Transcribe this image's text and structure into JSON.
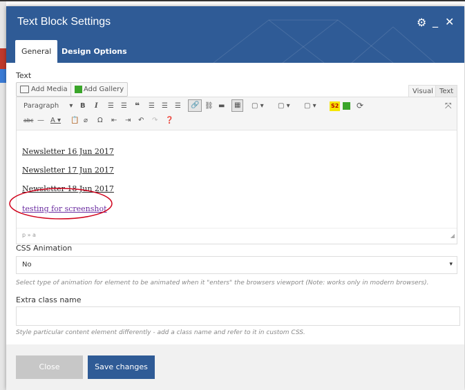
{
  "modal": {
    "title": "Text Block Settings",
    "tabs": [
      {
        "label": "General",
        "active": true
      },
      {
        "label": "Design Options",
        "active": false
      }
    ],
    "icons": {
      "settings": "gear-icon",
      "minimize": "minimize-icon",
      "close": "close-icon"
    }
  },
  "text_field": {
    "label": "Text",
    "add_media_label": "Add Media",
    "add_gallery_label": "Add Gallery",
    "editor_tabs": [
      {
        "label": "Visual",
        "active": true
      },
      {
        "label": "Text",
        "active": false
      }
    ],
    "paragraph_select": "Paragraph",
    "format_badge": "S2",
    "content_lines": [
      "Newsletter 16 Jun 2017",
      "Newsletter 17 Jun 2017",
      "Newsletter 18 Jun 2017",
      "testing for screenshot"
    ],
    "status_path": "p » a"
  },
  "css_animation": {
    "label": "CSS Animation",
    "value": "No",
    "help": "Select type of animation for element to be animated when it \"enters\" the browsers viewport (Note: works only in modern browsers)."
  },
  "extra_class": {
    "label": "Extra class name",
    "value": "",
    "help": "Style particular content element differently - add a class name and refer to it in custom CSS."
  },
  "footer": {
    "close_label": "Close",
    "save_label": "Save changes"
  },
  "colors": {
    "header": "#2f5b96",
    "save_button": "#2f5b96",
    "close_button": "#c7c7c7",
    "annotation": "#d0021b",
    "link_visited": "#6a2ba0"
  }
}
